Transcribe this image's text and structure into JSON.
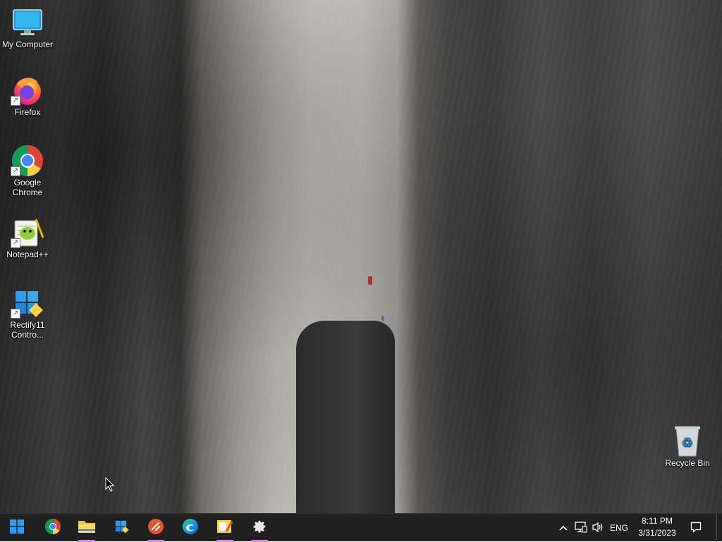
{
  "desktop_icons": [
    {
      "label": "My Computer",
      "icon": "monitor-icon"
    },
    {
      "label": "Firefox",
      "icon": "firefox-icon",
      "shortcut": true
    },
    {
      "label": "Google Chrome",
      "icon": "chrome-icon",
      "shortcut": true
    },
    {
      "label": "Notepad++",
      "icon": "notepadpp-icon",
      "shortcut": true
    },
    {
      "label": "Rectify11 Contro...",
      "icon": "rectify11-icon",
      "shortcut": true
    },
    {
      "label": "Recycle Bin",
      "icon": "recycle-bin-icon"
    }
  ],
  "taskbar": {
    "apps": [
      {
        "name": "Start",
        "icon": "windows-start-icon"
      },
      {
        "name": "Google Chrome",
        "icon": "chrome-icon"
      },
      {
        "name": "File Explorer",
        "icon": "folder-icon",
        "running": true
      },
      {
        "name": "Rectify11 Control Center",
        "icon": "rectify11-icon"
      },
      {
        "name": "App",
        "icon": "orange-circle-icon",
        "running": true
      },
      {
        "name": "Microsoft Edge",
        "icon": "edge-icon"
      },
      {
        "name": "Notepad",
        "icon": "notes-icon",
        "running": true
      },
      {
        "name": "Settings",
        "icon": "gear-icon",
        "running": true
      }
    ],
    "tray": {
      "language": "ENG",
      "time": "8:11 PM",
      "date": "3/31/2023"
    }
  },
  "colors": {
    "taskbar_bg": "#202020",
    "running_indicator": "#d88ae0",
    "accent": "#0078d4"
  }
}
